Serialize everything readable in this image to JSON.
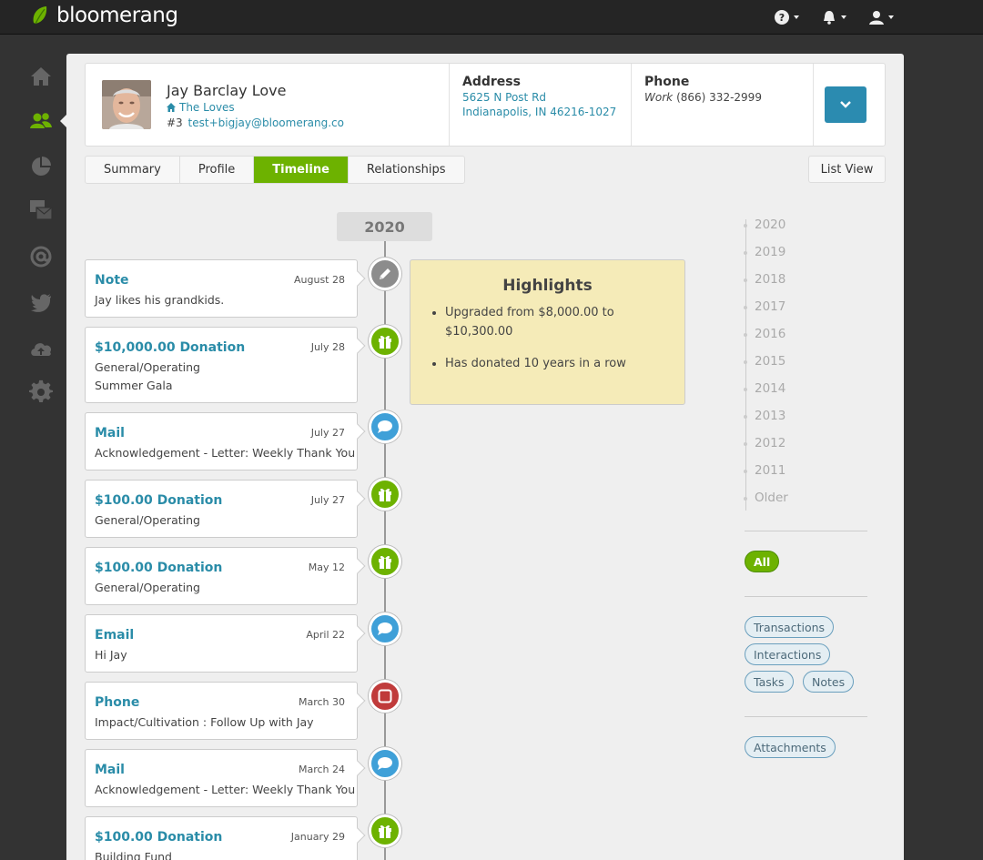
{
  "app": {
    "brand": "bloomerang"
  },
  "donor": {
    "name": "Jay Barclay Love",
    "household": "The Loves",
    "id": "#3",
    "email": "test+bigjay@bloomerang.co",
    "address_title": "Address",
    "address_line1": "5625 N Post Rd",
    "address_line2": "Indianapolis, IN 46216-1027",
    "phone_title": "Phone",
    "phone_type": "Work",
    "phone_number": "(866) 332-2999"
  },
  "tabs": [
    {
      "label": "Summary"
    },
    {
      "label": "Profile"
    },
    {
      "label": "Timeline"
    },
    {
      "label": "Relationships"
    }
  ],
  "list_view_label": "List View",
  "timeline": {
    "year": "2020",
    "entries": [
      {
        "title": "Note",
        "date": "August 28",
        "line1": "Jay likes his grandkids.",
        "line2": "",
        "icon": "pencil-icon"
      },
      {
        "title": "$10,000.00 Donation",
        "date": "July 28",
        "line1": "General/Operating",
        "line2": "Summer Gala",
        "icon": "gift-icon"
      },
      {
        "title": "Mail",
        "date": "July 27",
        "line1": "Acknowledgement - Letter: Weekly Thank You",
        "line2": "",
        "icon": "chat-icon"
      },
      {
        "title": "$100.00 Donation",
        "date": "July 27",
        "line1": "General/Operating",
        "line2": "",
        "icon": "gift-icon"
      },
      {
        "title": "$100.00 Donation",
        "date": "May 12",
        "line1": "General/Operating",
        "line2": "",
        "icon": "gift-icon"
      },
      {
        "title": "Email",
        "date": "April 22",
        "line1": "Hi Jay",
        "line2": "",
        "icon": "chat-icon"
      },
      {
        "title": "Phone",
        "date": "March 30",
        "line1": "Impact/Cultivation : Follow Up with Jay",
        "line2": "",
        "icon": "phone-icon"
      },
      {
        "title": "Mail",
        "date": "March 24",
        "line1": "Acknowledgement - Letter: Weekly Thank You",
        "line2": "",
        "icon": "chat-icon"
      },
      {
        "title": "$100.00 Donation",
        "date": "January 29",
        "line1": "Building Fund",
        "line2": "",
        "icon": "gift-icon"
      }
    ]
  },
  "highlights": {
    "title": "Highlights",
    "items": [
      "Upgraded from $8,000.00 to $10,300.00",
      "Has donated 10 years in a row"
    ]
  },
  "years": [
    "2020",
    "2019",
    "2018",
    "2017",
    "2016",
    "2015",
    "2014",
    "2013",
    "2012",
    "2011",
    "Older"
  ],
  "filters": {
    "all": "All",
    "transactions": "Transactions",
    "interactions": "Interactions",
    "tasks": "Tasks",
    "notes": "Notes",
    "attachments": "Attachments"
  },
  "colors": {
    "accent_green": "#6db200",
    "link_blue": "#2a8ca8",
    "button_blue": "#2b8bb0",
    "highlight_bg": "#f5ebb8"
  }
}
